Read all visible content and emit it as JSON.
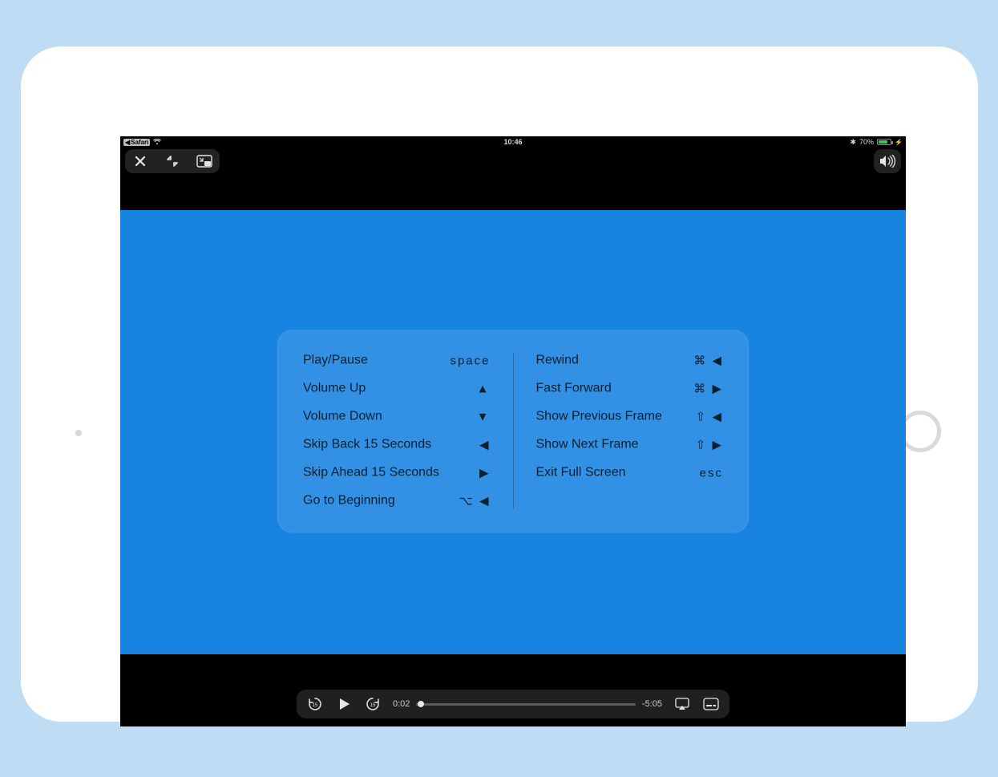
{
  "status": {
    "back_app": "Safari",
    "time": "10:46",
    "battery_pct": "70%"
  },
  "shortcuts": {
    "left": [
      {
        "label": "Play/Pause",
        "key": "space"
      },
      {
        "label": "Volume Up",
        "key": "▲"
      },
      {
        "label": "Volume Down",
        "key": "▼"
      },
      {
        "label": "Skip Back 15 Seconds",
        "key": "◀"
      },
      {
        "label": "Skip Ahead 15 Seconds",
        "key": "▶"
      },
      {
        "label": "Go to Beginning",
        "key": "⌥ ◀"
      }
    ],
    "right": [
      {
        "label": "Rewind",
        "key": "⌘ ◀"
      },
      {
        "label": "Fast Forward",
        "key": "⌘ ▶"
      },
      {
        "label": "Show Previous Frame",
        "key": "⇧ ◀"
      },
      {
        "label": "Show Next Frame",
        "key": "⇧ ▶"
      },
      {
        "label": "Exit Full Screen",
        "key": "esc"
      }
    ]
  },
  "player": {
    "elapsed": "0:02",
    "remaining": "-5:05",
    "skip_back_seconds": "15",
    "skip_fwd_seconds": "15"
  },
  "icons": {
    "close": "close-icon",
    "minimize": "minimize-icon",
    "pip": "pip-icon",
    "volume": "volume-icon",
    "airplay": "airplay-icon",
    "subtitles": "subtitles-icon"
  }
}
